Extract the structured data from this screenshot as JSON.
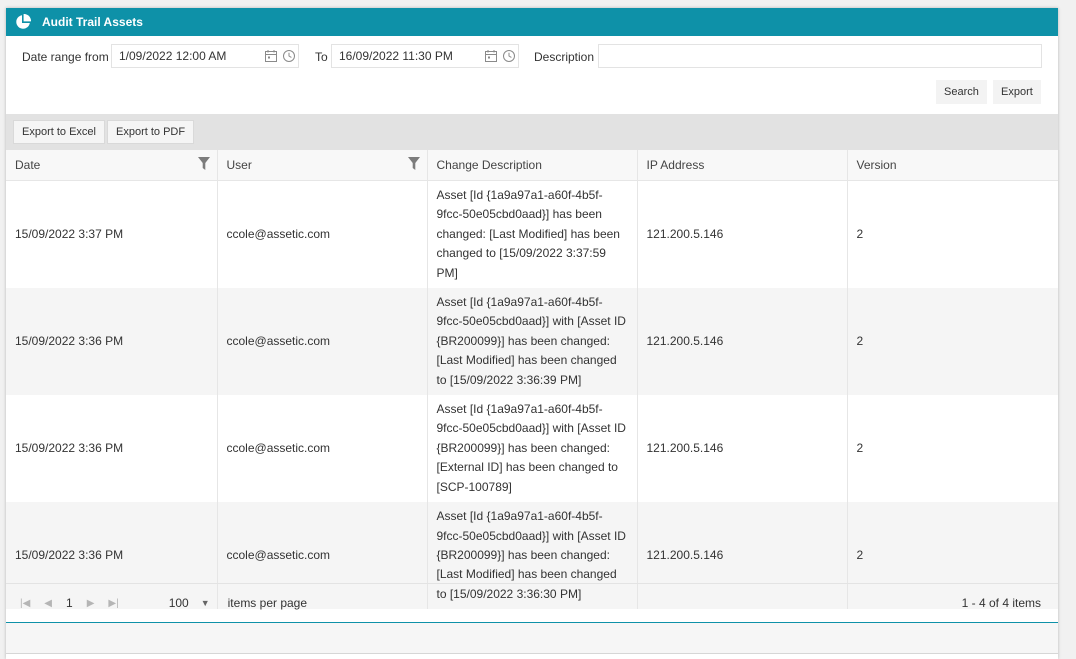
{
  "header": {
    "title": "Audit Trail Assets",
    "icon": "pie-chart-icon",
    "color": "#0e91a8"
  },
  "filters": {
    "date_from_label": "Date range from",
    "date_from_value": "1/09/2022 12:00 AM",
    "date_to_label": "To",
    "date_to_value": "16/09/2022 11:30 PM",
    "description_label": "Description",
    "description_value": "",
    "search_label": "Search",
    "export_label": "Export"
  },
  "toolbar": {
    "export_excel_label": "Export to Excel",
    "export_pdf_label": "Export to PDF"
  },
  "grid": {
    "columns": [
      "Date",
      "User",
      "Change Description",
      "IP Address",
      "Version"
    ],
    "rows": [
      {
        "date": "15/09/2022 3:37 PM",
        "user": "ccole@assetic.com",
        "change": "Asset [Id {1a9a97a1-a60f-4b5f-9fcc-50e05cbd0aad}] has been changed: [Last Modified] has been changed to [15/09/2022 3:37:59 PM]",
        "ip": "121.200.5.146",
        "version": "2"
      },
      {
        "date": "15/09/2022 3:36 PM",
        "user": "ccole@assetic.com",
        "change": "Asset [Id {1a9a97a1-a60f-4b5f-9fcc-50e05cbd0aad}] with [Asset ID {BR200099}] has been changed: [Last Modified] has been changed to [15/09/2022 3:36:39 PM]",
        "ip": "121.200.5.146",
        "version": "2"
      },
      {
        "date": "15/09/2022 3:36 PM",
        "user": "ccole@assetic.com",
        "change": "Asset [Id {1a9a97a1-a60f-4b5f-9fcc-50e05cbd0aad}] with [Asset ID {BR200099}] has been changed: [External ID] has been changed to [SCP-100789]",
        "ip": "121.200.5.146",
        "version": "2"
      },
      {
        "date": "15/09/2022 3:36 PM",
        "user": "ccole@assetic.com",
        "change": "Asset [Id {1a9a97a1-a60f-4b5f-9fcc-50e05cbd0aad}] with [Asset ID {BR200099}] has been changed: [Last Modified] has been changed to [15/09/2022 3:36:30 PM]",
        "ip": "121.200.5.146",
        "version": "2"
      }
    ]
  },
  "pager": {
    "current_page": "1",
    "page_size": "100",
    "items_per_page_label": "items per page",
    "info": "1 - 4 of 4 items"
  }
}
